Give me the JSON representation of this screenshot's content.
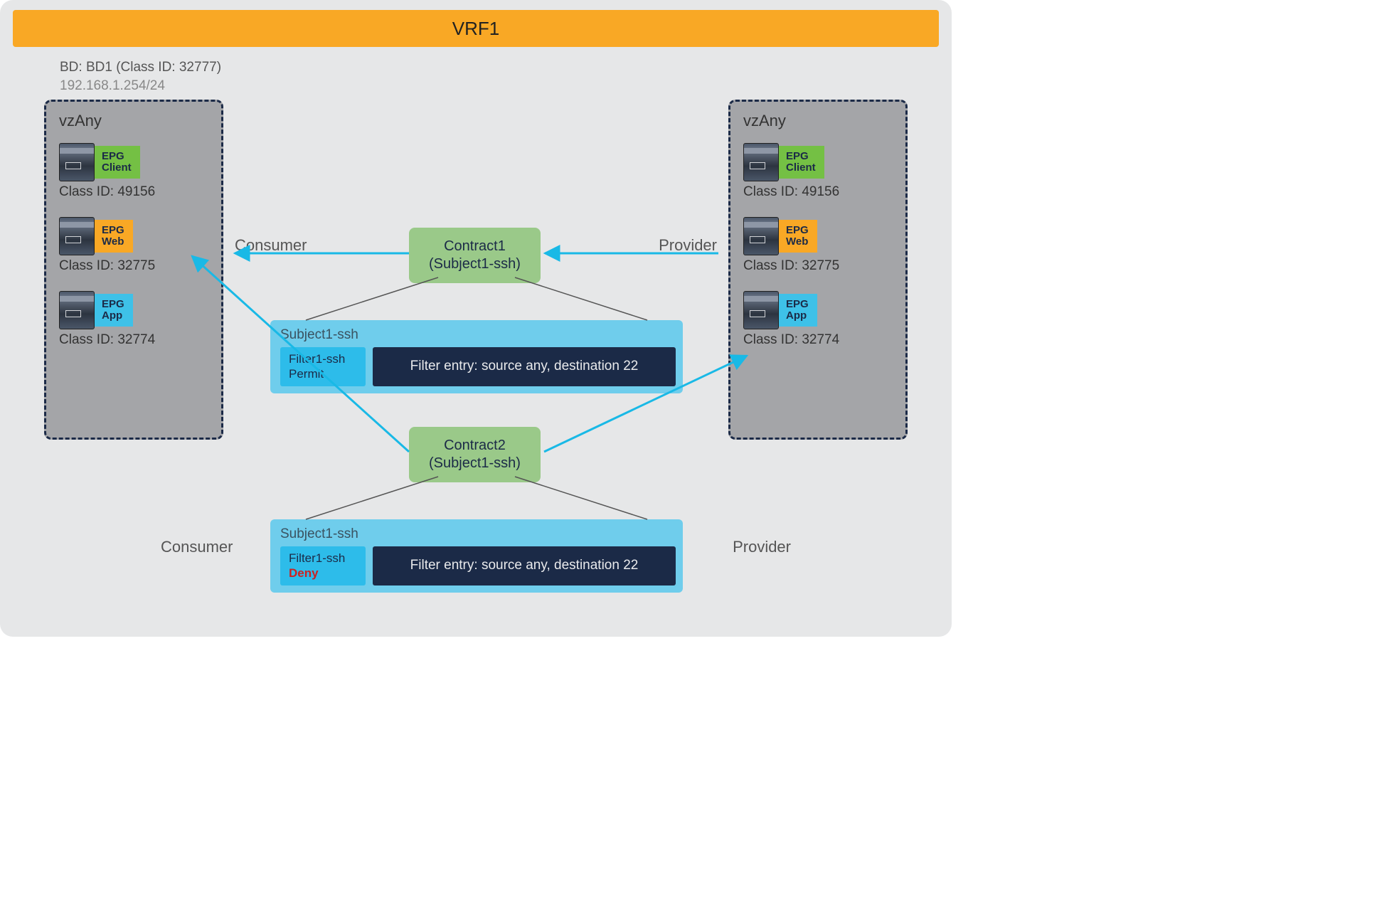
{
  "vrf": {
    "title": "VRF1"
  },
  "bd": {
    "label": "BD: BD1 (Class ID: 32777)",
    "subnet": "192.168.1.254/24"
  },
  "vzany": {
    "title": "vzAny",
    "epgLabel": "EPG",
    "epgs": [
      {
        "name": "Client",
        "color": "green",
        "classId": "Class ID: 49156"
      },
      {
        "name": "Web",
        "color": "orange",
        "classId": "Class ID: 32775"
      },
      {
        "name": "App",
        "color": "blue",
        "classId": "Class ID: 32774"
      }
    ]
  },
  "labels": {
    "consumer": "Consumer",
    "provider": "Provider"
  },
  "contract1": {
    "name": "Contract1",
    "subject": "(Subject1-ssh)",
    "subjectTitle": "Subject1-ssh",
    "filterName": "Filter1-ssh",
    "action": "Permit",
    "entry": "Filter entry: source any, destination 22"
  },
  "contract2": {
    "name": "Contract2",
    "subject": "(Subject1-ssh)",
    "subjectTitle": "Subject1-ssh",
    "filterName": "Filter1-ssh",
    "action": "Deny",
    "entry": "Filter entry: source any, destination 22"
  }
}
